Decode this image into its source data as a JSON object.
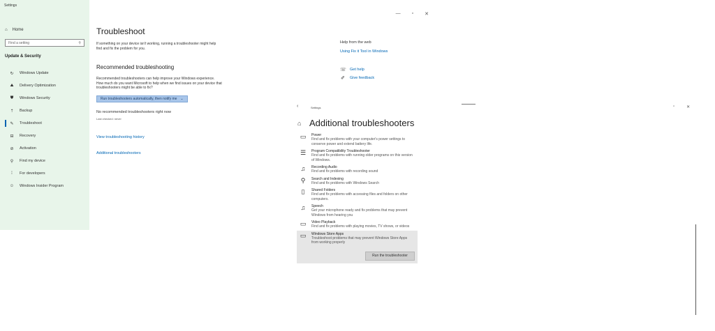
{
  "window1": {
    "app_title": "Settings",
    "caption": {
      "min": "—",
      "max": "▫",
      "close": "✕"
    },
    "sidebar": {
      "home": "Home",
      "search_placeholder": "Find a setting",
      "section": "Update & Security",
      "items": [
        {
          "label": "Windows Update",
          "icon": "↻"
        },
        {
          "label": "Delivery Optimization",
          "icon": "⛰"
        },
        {
          "label": "Windows Security",
          "icon": "⛊"
        },
        {
          "label": "Backup",
          "icon": "⇡"
        },
        {
          "label": "Troubleshoot",
          "icon": "✎"
        },
        {
          "label": "Recovery",
          "icon": "⊟"
        },
        {
          "label": "Activation",
          "icon": "⊘"
        },
        {
          "label": "Find my device",
          "icon": "⚲"
        },
        {
          "label": "For developers",
          "icon": "⁞"
        },
        {
          "label": "Windows Insider Program",
          "icon": "☺"
        }
      ]
    },
    "main": {
      "title": "Troubleshoot",
      "intro": "If something on your device isn't working, running a troubleshooter might help find and fix the problem for you.",
      "recommended_heading": "Recommended troubleshooting",
      "recommended_body": "Recommended troubleshooters can help improve your Windows experience. How much do you want Microsoft to help when we find issues on your device that troubleshooters might be able to fix?",
      "run_option": "Run troubleshooters automatically, then notify me",
      "no_recommended": "No recommended troubleshooters right now",
      "last_checked": "Last checked: never",
      "history_link": "View troubleshooting history",
      "additional_link": "Additional troubleshooters"
    },
    "help": {
      "title": "Help from the web",
      "web_link": "Using Fix it Tool in Windows",
      "get_help": "Get help",
      "give_feedback": "Give feedback"
    }
  },
  "window2": {
    "app_title": "Settings",
    "caption": {
      "back": "‹",
      "max": "▫",
      "close": "✕"
    },
    "title": "Additional troubleshooters",
    "items": [
      {
        "name": "Power",
        "desc": "Find and fix problems with your computer's power settings to conserve power and extend battery life.",
        "icon": "▭"
      },
      {
        "name": "Program Compatibility Troubleshooter",
        "desc": "Find and fix problems with running older programs on this version of Windows.",
        "icon": "☰"
      },
      {
        "name": "Recording Audio",
        "desc": "Find and fix problems with recording sound",
        "icon": "♫"
      },
      {
        "name": "Search and Indexing",
        "desc": "Find and fix problems with Windows Search",
        "icon": "⚲"
      },
      {
        "name": "Shared Folders",
        "desc": "Find and fix problems with accessing files and folders on other computers.",
        "icon": "▯"
      },
      {
        "name": "Speech",
        "desc": "Get your microphone ready and fix problems that may prevent Windows from hearing you",
        "icon": "♫"
      },
      {
        "name": "Video Playback",
        "desc": "Find and fix problems with playing movies, TV shows, or videos",
        "icon": "▭"
      },
      {
        "name": "Windows Store Apps",
        "desc": "Troubleshoot problems that may prevent Windows Store Apps from working properly",
        "icon": "▭"
      }
    ],
    "run_button": "Run the troubleshooter"
  },
  "colors": {
    "sidebar_bg": "#e8f5ea",
    "accent": "#0063b1",
    "link": "#0066b4",
    "selected_bg": "#e6e6e6"
  }
}
